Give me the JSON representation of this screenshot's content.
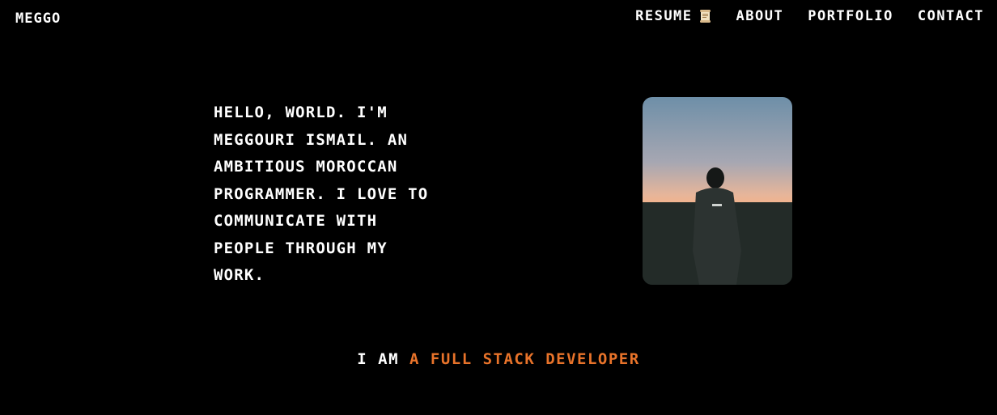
{
  "brand": {
    "logo_text": "MEGGO"
  },
  "nav": {
    "items": [
      {
        "label": "RESUME",
        "icon": "scroll-icon"
      },
      {
        "label": "ABOUT"
      },
      {
        "label": "PORTFOLIO"
      },
      {
        "label": "CONTACT"
      }
    ]
  },
  "hero": {
    "intro_text": "HELLO, WORLD. I'M MEGGOURI ISMAIL. AN AMBITIOUS MOROCCAN PROGRAMMER. I LOVE TO COMMUNICATE WITH PEOPLE THROUGH MY WORK.",
    "photo_icon": "portrait-photo"
  },
  "tagline": {
    "prefix": "I AM",
    "highlight": "A FULL STACK DEVELOPER"
  },
  "colors": {
    "background": "#000000",
    "text": "#ffffff",
    "accent": "#e8732a"
  }
}
